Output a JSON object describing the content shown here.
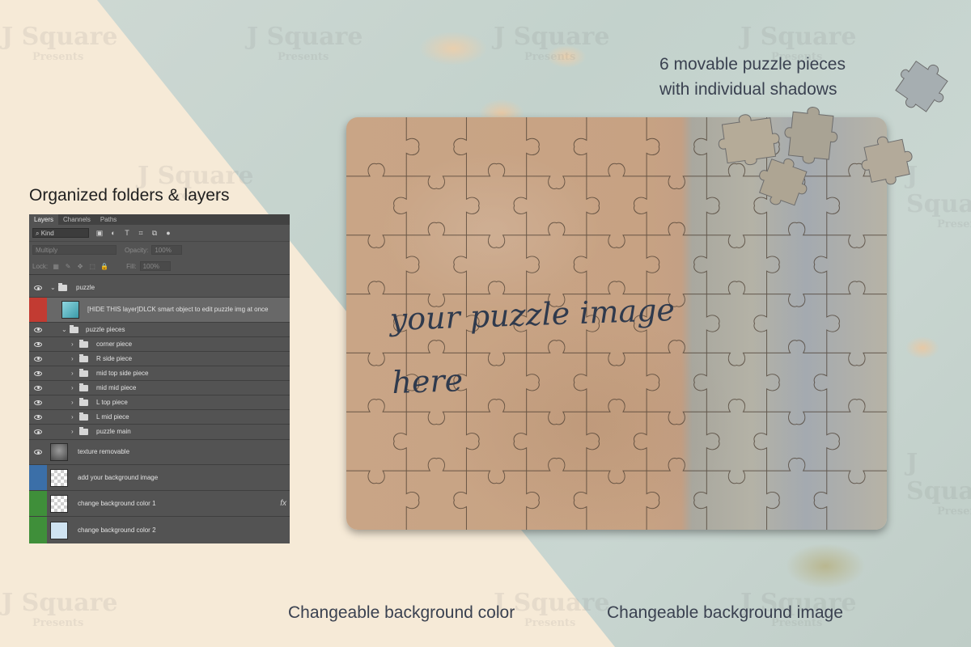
{
  "watermark": {
    "title": "J Square",
    "subtitle": "Presents"
  },
  "captions": {
    "pieces_line1": "6 movable puzzle pieces",
    "pieces_line2": "with individual shadows",
    "folders": "Organized folders & layers",
    "bg_color": "Changeable background color",
    "bg_image": "Changeable background image"
  },
  "puzzle": {
    "text_line1": "your puzzle image",
    "text_line2": "here",
    "grid": {
      "cols": 9,
      "rows": 7
    }
  },
  "layers_panel": {
    "tabs": [
      "Layers",
      "Channels",
      "Paths"
    ],
    "kind_label": "Kind",
    "blend_mode": "Multiply",
    "opacity_label": "Opacity:",
    "opacity_value": "100%",
    "lock_label": "Lock:",
    "fill_label": "Fill:",
    "fill_value": "100%",
    "layers": [
      {
        "name": "puzzle",
        "type": "group"
      },
      {
        "name": "[HIDE THIS layer]DLCK smart object to edit puzzle img at once",
        "type": "smart-object",
        "eye_color": "#c23b32"
      },
      {
        "name": "puzzle pieces",
        "type": "group"
      },
      {
        "name": "corner piece",
        "type": "group"
      },
      {
        "name": "R side piece",
        "type": "group"
      },
      {
        "name": "mid top side piece",
        "type": "group"
      },
      {
        "name": "mid mid piece",
        "type": "group"
      },
      {
        "name": "L top piece",
        "type": "group"
      },
      {
        "name": "L mid piece",
        "type": "group"
      },
      {
        "name": "puzzle main",
        "type": "group"
      },
      {
        "name": "texture removable",
        "type": "layer"
      },
      {
        "name": "add your background image",
        "type": "layer",
        "eye_color": "#3b6fa8"
      },
      {
        "name": "change background color 1",
        "type": "layer",
        "eye_color": "#3f8f3a",
        "fx": "fx"
      },
      {
        "name": "change background color 2",
        "type": "layer",
        "eye_color": "#3f8f3a"
      }
    ]
  },
  "colors": {
    "caption": "#3a4150",
    "panel_bg": "#535353",
    "cream": "#f6ead7",
    "wall": "#c6d4cf"
  }
}
